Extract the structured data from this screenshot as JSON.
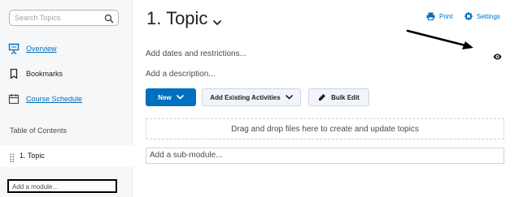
{
  "sidebar": {
    "search_placeholder": "Search Topics",
    "nav": [
      {
        "label": "Overview",
        "icon": "presentation-board-icon"
      },
      {
        "label": "Bookmarks",
        "icon": "bookmark-icon"
      },
      {
        "label": "Course Schedule",
        "icon": "calendar-icon"
      }
    ],
    "toc_heading": "Table of Contents",
    "toc_items": [
      {
        "label": "1. Topic"
      }
    ],
    "add_module_text": "Add a module..."
  },
  "main": {
    "title": "1. Topic",
    "print_label": "Print",
    "settings_label": "Settings",
    "dates_text": "Add dates and restrictions...",
    "description_text": "Add a description...",
    "new_button_label": "New",
    "add_existing_label": "Add Existing Activities",
    "bulk_edit_label": "Bulk Edit",
    "dropzone_text": "Drag and drop files here to create and update topics",
    "submodule_text": "Add a sub-module..."
  },
  "colors": {
    "accent": "#006fbf",
    "sidebar_bg": "#f6f7f8",
    "annotation": "#000000"
  }
}
